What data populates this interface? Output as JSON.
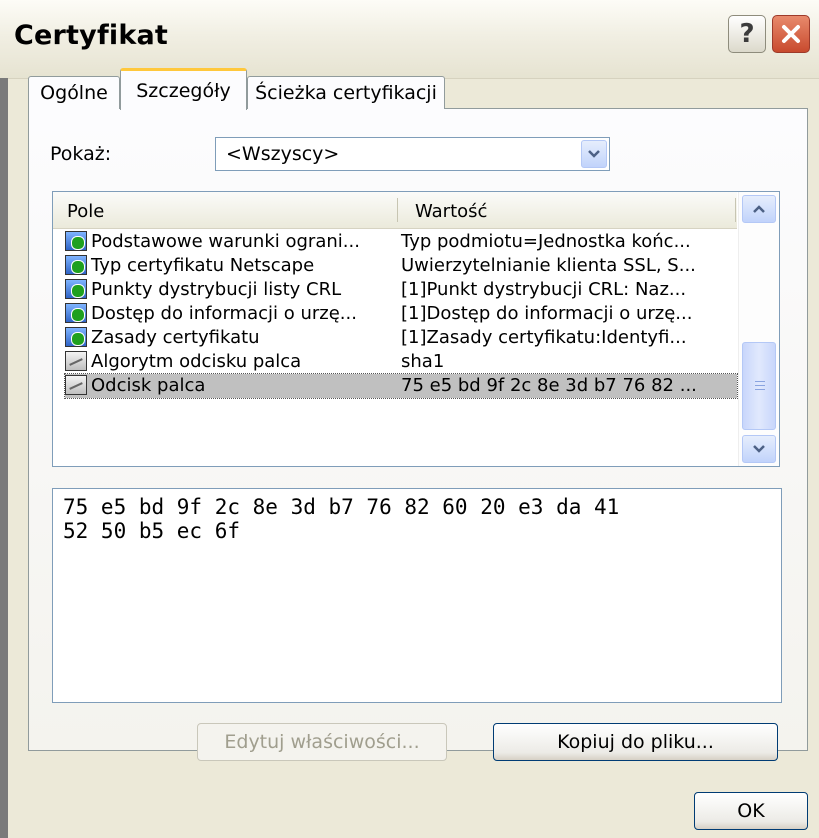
{
  "window": {
    "title": "Certyfikat"
  },
  "tabs": [
    {
      "label": "Ogólne"
    },
    {
      "label": "Szczegóły"
    },
    {
      "label": "Ścieżka certyfikacji"
    }
  ],
  "show": {
    "label": "Pokaż:",
    "value": "<Wszyscy>"
  },
  "list": {
    "columns": {
      "field": "Pole",
      "value": "Wartość"
    },
    "rows": [
      {
        "field": "Podstawowe warunki ograni...",
        "value": "Typ podmiotu=Jednostka końc...",
        "icon": "extension-icon"
      },
      {
        "field": "Typ certyfikatu Netscape",
        "value": "Uwierzytelnianie klienta SSL, S...",
        "icon": "extension-icon"
      },
      {
        "field": "Punkty dystrybucji listy CRL",
        "value": "[1]Punkt dystrybucji CRL: Naz...",
        "icon": "extension-icon"
      },
      {
        "field": "Dostęp do informacji o urzę...",
        "value": "[1]Dostęp do informacji o urzę...",
        "icon": "extension-icon"
      },
      {
        "field": "Zasady certyfikatu",
        "value": "[1]Zasady certyfikatu:Identyfi...",
        "icon": "extension-icon"
      },
      {
        "field": "Algorytm odcisku palca",
        "value": "sha1",
        "icon": "property-icon"
      },
      {
        "field": "Odcisk palca",
        "value": "75 e5 bd 9f 2c 8e 3d b7 76 82 ...",
        "icon": "property-icon",
        "selected": true
      }
    ]
  },
  "details": {
    "lines": [
      "75 e5 bd 9f 2c 8e 3d b7 76 82 60 20 e3 da 41",
      "52 50 b5 ec 6f"
    ]
  },
  "buttons": {
    "edit": "Edytuj właściwości...",
    "copy": "Kopiuj do pliku...",
    "ok": "OK"
  },
  "colors": {
    "dialog_bg": "#ece9d8",
    "selected_tab_accent": "#ffc83c",
    "close_button": "#c84a2e",
    "selected_row": "#c0c0c0"
  }
}
